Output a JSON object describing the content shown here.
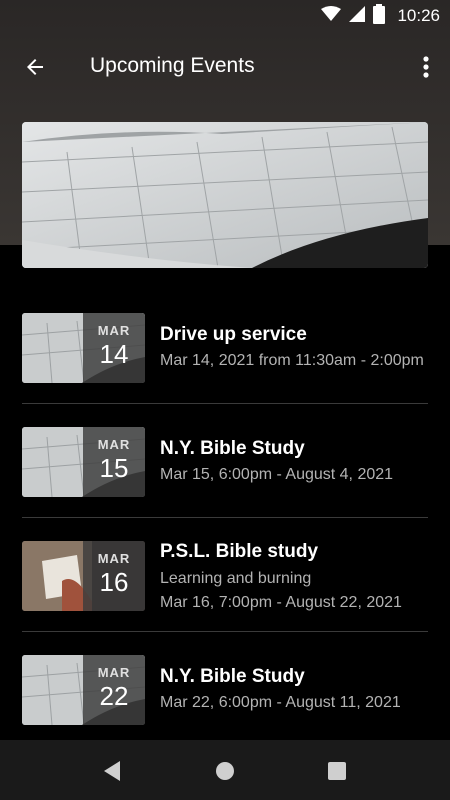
{
  "status": {
    "time": "10:26"
  },
  "header": {
    "title": "Upcoming Events"
  },
  "events": [
    {
      "month": "MAR",
      "day": "14",
      "title": "Drive up service",
      "lines": [
        "Mar 14, 2021 from 11:30am - 2:00pm"
      ]
    },
    {
      "month": "MAR",
      "day": "15",
      "title": "N.Y. Bible Study",
      "lines": [
        "Mar 15, 6:00pm - August 4, 2021"
      ]
    },
    {
      "month": "MAR",
      "day": "16",
      "title": "P.S.L. Bible study",
      "lines": [
        "Learning and burning",
        "Mar 16, 7:00pm - August 22, 2021"
      ]
    },
    {
      "month": "MAR",
      "day": "22",
      "title": "N.Y. Bible Study",
      "lines": [
        "Mar 22, 6:00pm - August 11, 2021"
      ]
    }
  ],
  "colors": {
    "background": "#000000",
    "header_bg": "#2e2a28",
    "nav_bg": "#1a1a1a",
    "date_overlay": "#3c3c3c"
  },
  "icons": {
    "back": "arrow-left-icon",
    "menu": "more-vert-icon",
    "wifi": "wifi-icon",
    "signal": "signal-icon",
    "battery": "battery-icon",
    "nav_back": "triangle-back-icon",
    "nav_home": "circle-home-icon",
    "nav_recents": "square-recents-icon"
  }
}
